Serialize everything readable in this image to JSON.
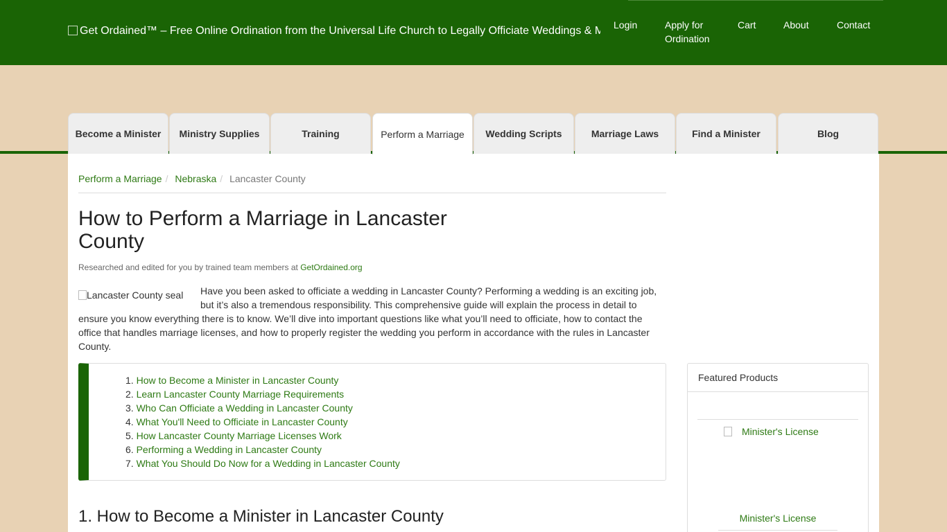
{
  "header": {
    "logo_alt": "Get Ordained™ – Free Online Ordination from the Universal Life Church to Legally Officiate Weddings & More",
    "nav": {
      "login": "Login",
      "apply_line1": "Apply for",
      "apply_line2": "Ordination",
      "cart": "Cart",
      "about": "About",
      "contact": "Contact"
    }
  },
  "tabs": [
    {
      "label": "Become a Minister"
    },
    {
      "label": "Ministry Supplies"
    },
    {
      "label": "Training"
    },
    {
      "label": "Perform a Marriage",
      "active": true
    },
    {
      "label": "Wedding Scripts"
    },
    {
      "label": "Marriage Laws"
    },
    {
      "label": "Find a Minister"
    },
    {
      "label": "Blog"
    }
  ],
  "breadcrumb": {
    "items": [
      "Perform a Marriage",
      "Nebraska"
    ],
    "current": "Lancaster County",
    "separator": "/"
  },
  "article": {
    "title": "How to Perform a Marriage in Lancaster County",
    "byline_prefix": "Researched and edited for you by trained team members at ",
    "byline_link": "GetOrdained.org",
    "seal_alt": "Lancaster County seal",
    "intro": "Have you been asked to officiate a wedding in Lancaster County? Performing a wedding is an exciting job, but it’s also a tremendous responsibility. This comprehensive guide will explain the process in detail to ensure you know everything there is to know. We’ll dive into important questions like what you’ll need to officiate, how to contact the office that handles marriage licenses, and how to properly register the wedding you perform in accordance with the rules in Lancaster County.",
    "toc": [
      {
        "num": "1.",
        "label": "How to Become a Minister in Lancaster County"
      },
      {
        "num": "2.",
        "label": "Learn Lancaster County Marriage Requirements"
      },
      {
        "num": "3.",
        "label": "Who Can Officiate a Wedding in Lancaster County"
      },
      {
        "num": "4.",
        "label": "What You'll Need to Officiate in Lancaster County"
      },
      {
        "num": "5.",
        "label": "How Lancaster County Marriage Licenses Work"
      },
      {
        "num": "6.",
        "label": "Performing a Wedding in Lancaster County"
      },
      {
        "num": "7.",
        "label": "What You Should Do Now for a Wedding in Lancaster County"
      }
    ],
    "section1_heading": "1. How to Become a Minister in Lancaster County"
  },
  "sidebar": {
    "featured_title": "Featured Products",
    "product_img_alt": "Minister's License",
    "product_name": "Minister's License"
  },
  "colors": {
    "brand_green": "#1a6405",
    "link_green": "#2e7a14",
    "page_bg": "#e8d2b4"
  }
}
